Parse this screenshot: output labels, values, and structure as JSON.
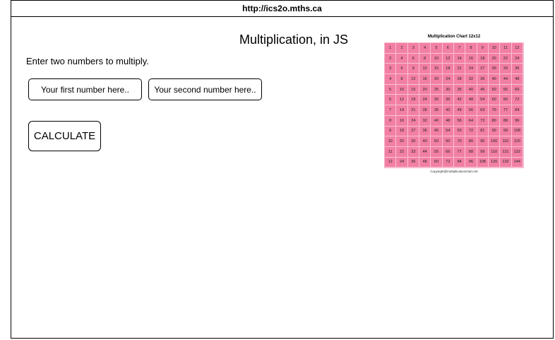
{
  "browser": {
    "url": "http://ics2o.mths.ca"
  },
  "page": {
    "title": "Multiplication, in JS",
    "prompt": "Enter two numbers to multiply.",
    "first_placeholder": "Your first number here..",
    "second_placeholder": "Your second number here..",
    "calculate_label": "CALCULATE"
  },
  "chart_image": {
    "title": "Multiplication Chart 12x12",
    "copyright": "Copyright@multiplicationchart.net",
    "rows": 12,
    "cols": 12,
    "cell_color": "#f27fa4"
  }
}
